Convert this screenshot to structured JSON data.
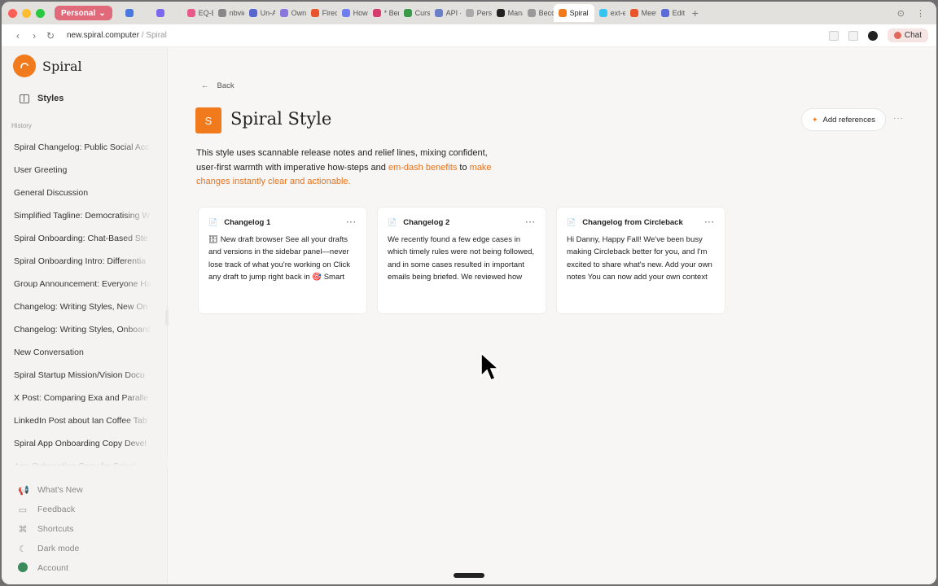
{
  "browser": {
    "profile": "Personal",
    "tabs": [
      {
        "label": "",
        "color": "#4a78e0"
      },
      {
        "label": "",
        "color": "#7b68ee"
      },
      {
        "label": "EQ-Bi",
        "color": "#e85a8a"
      },
      {
        "label": "nbvie",
        "color": "#888888"
      },
      {
        "label": "Un-AI",
        "color": "#5566cc"
      },
      {
        "label": "Owne",
        "color": "#8877dd"
      },
      {
        "label": "Firecr",
        "color": "#e8552a"
      },
      {
        "label": "How c",
        "color": "#6f7ff0"
      },
      {
        "label": "* Ben",
        "color": "#d43c6e"
      },
      {
        "label": "Curso",
        "color": "#3a9a4a"
      },
      {
        "label": "API -",
        "color": "#6b7ec8"
      },
      {
        "label": "Perso",
        "color": "#aaaaaa"
      },
      {
        "label": "Mana",
        "color": "#222222"
      },
      {
        "label": "Becor",
        "color": "#999999"
      },
      {
        "label": "Spiral",
        "color": "#f07a1c",
        "active": true
      },
      {
        "label": "ext-e",
        "color": "#36c5f0"
      },
      {
        "label": "Meeti",
        "color": "#e8552a"
      },
      {
        "label": "Edit C",
        "color": "#5b6bd8"
      }
    ],
    "url_host": "new.spiral.computer",
    "url_path": " / Spiral",
    "chat_label": "Chat"
  },
  "sidebar": {
    "brand": "Spiral",
    "styles_label": "Styles",
    "history_label": "History",
    "history": [
      "Spiral Changelog: Public Social Acc",
      "User Greeting",
      "General Discussion",
      "Simplified Tagline: Democratising W",
      "Spiral Onboarding: Chat-Based Ste",
      "Spiral Onboarding Intro: Differentia",
      "Group Announcement: Everyone Ha",
      "Changelog: Writing Styles, New On",
      "Changelog: Writing Styles, Onboard",
      "New Conversation",
      "Spiral Startup Mission/Vision Docu",
      "X Post: Comparing Exa and Paralle",
      "LinkedIn Post about Ian Coffee Tab",
      "Spiral App Onboarding Copy Devel",
      "App Onboarding Copy for Spiral"
    ],
    "bottom": {
      "whats_new": "What's New",
      "feedback": "Feedback",
      "shortcuts": "Shortcuts",
      "dark_mode": "Dark mode",
      "account": "Account"
    }
  },
  "main": {
    "back_label": "Back",
    "badge": "S",
    "title": "Spiral Style",
    "add_references": "Add references",
    "description": {
      "part1": "This style uses scannable release notes and relief lines, mixing confident, user-first warmth with imperative how-steps and ",
      "highlight1": "em-dash benefits",
      "part2": " to ",
      "highlight2": "make changes instantly clear and actionable."
    },
    "cards": [
      {
        "title": "Changelog 1",
        "body": "🗄 New draft browser See all your drafts and versions in the sidebar panel—never lose track of what you're working on Click any draft to jump right back in 🎯 Smart draft replacement When you ask"
      },
      {
        "title": "Changelog 2",
        "body": "We recently found a few edge cases in which timely rules were not being followed, and in some cases resulted in important emails being briefed. We reviewed how Cora handles rules per"
      },
      {
        "title": "Changelog from Circleback",
        "body": "Hi Danny,   Happy Fall! We've been busy making Circleback better for you, and I'm excited to share what's new.   Add your own notes You can now add your own context to any meeting—before it starts"
      }
    ]
  }
}
